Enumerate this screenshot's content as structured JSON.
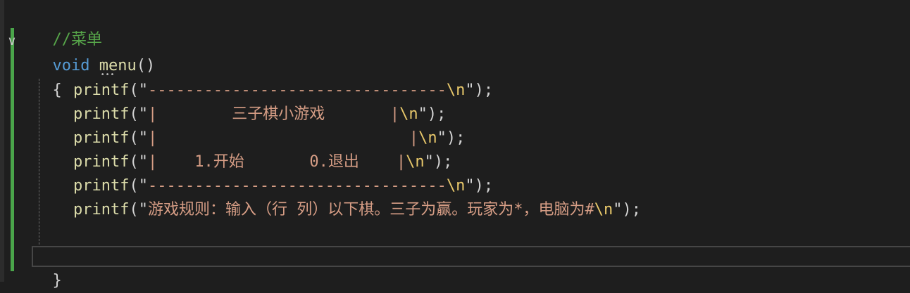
{
  "editor": {
    "comment": "//菜单",
    "signature": {
      "keyword": "void",
      "name": "menu",
      "parens": "()"
    },
    "open_brace": "{",
    "close_brace": "}",
    "print_lines": [
      {
        "fn": "printf",
        "open": "(\"",
        "text": "--------------------------------",
        "esc": "\\n",
        "close": "\");"
      },
      {
        "fn": "printf",
        "open": "(\"",
        "text": "|        三子棋小游戏       |",
        "esc": "\\n",
        "close": "\");"
      },
      {
        "fn": "printf",
        "open": "(\"",
        "text": "|                           |",
        "esc": "\\n",
        "close": "\");"
      },
      {
        "fn": "printf",
        "open": "(\"",
        "text": "|    1.开始       0.退出    |",
        "esc": "\\n",
        "close": "\");"
      },
      {
        "fn": "printf",
        "open": "(\"",
        "text": "--------------------------------",
        "esc": "\\n",
        "close": "\");"
      },
      {
        "fn": "printf",
        "open": "(\"",
        "text": "游戏规则：输入（行 列）以下棋。三子为赢。玩家为*，电脑为#",
        "esc": "\\n",
        "close": "\");"
      }
    ]
  },
  "icons": {
    "fold": "chevron-down-icon"
  }
}
